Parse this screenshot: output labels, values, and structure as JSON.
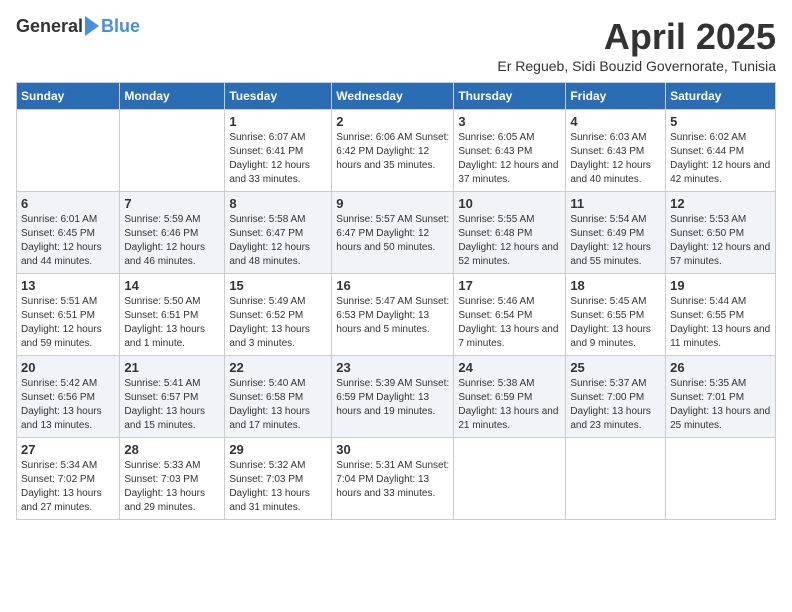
{
  "logo": {
    "general": "General",
    "blue": "Blue"
  },
  "title": {
    "month": "April 2025",
    "location": "Er Regueb, Sidi Bouzid Governorate, Tunisia"
  },
  "columns": [
    "Sunday",
    "Monday",
    "Tuesday",
    "Wednesday",
    "Thursday",
    "Friday",
    "Saturday"
  ],
  "weeks": [
    [
      {
        "day": "",
        "info": ""
      },
      {
        "day": "",
        "info": ""
      },
      {
        "day": "1",
        "info": "Sunrise: 6:07 AM\nSunset: 6:41 PM\nDaylight: 12 hours and 33 minutes."
      },
      {
        "day": "2",
        "info": "Sunrise: 6:06 AM\nSunset: 6:42 PM\nDaylight: 12 hours and 35 minutes."
      },
      {
        "day": "3",
        "info": "Sunrise: 6:05 AM\nSunset: 6:43 PM\nDaylight: 12 hours and 37 minutes."
      },
      {
        "day": "4",
        "info": "Sunrise: 6:03 AM\nSunset: 6:43 PM\nDaylight: 12 hours and 40 minutes."
      },
      {
        "day": "5",
        "info": "Sunrise: 6:02 AM\nSunset: 6:44 PM\nDaylight: 12 hours and 42 minutes."
      }
    ],
    [
      {
        "day": "6",
        "info": "Sunrise: 6:01 AM\nSunset: 6:45 PM\nDaylight: 12 hours and 44 minutes."
      },
      {
        "day": "7",
        "info": "Sunrise: 5:59 AM\nSunset: 6:46 PM\nDaylight: 12 hours and 46 minutes."
      },
      {
        "day": "8",
        "info": "Sunrise: 5:58 AM\nSunset: 6:47 PM\nDaylight: 12 hours and 48 minutes."
      },
      {
        "day": "9",
        "info": "Sunrise: 5:57 AM\nSunset: 6:47 PM\nDaylight: 12 hours and 50 minutes."
      },
      {
        "day": "10",
        "info": "Sunrise: 5:55 AM\nSunset: 6:48 PM\nDaylight: 12 hours and 52 minutes."
      },
      {
        "day": "11",
        "info": "Sunrise: 5:54 AM\nSunset: 6:49 PM\nDaylight: 12 hours and 55 minutes."
      },
      {
        "day": "12",
        "info": "Sunrise: 5:53 AM\nSunset: 6:50 PM\nDaylight: 12 hours and 57 minutes."
      }
    ],
    [
      {
        "day": "13",
        "info": "Sunrise: 5:51 AM\nSunset: 6:51 PM\nDaylight: 12 hours and 59 minutes."
      },
      {
        "day": "14",
        "info": "Sunrise: 5:50 AM\nSunset: 6:51 PM\nDaylight: 13 hours and 1 minute."
      },
      {
        "day": "15",
        "info": "Sunrise: 5:49 AM\nSunset: 6:52 PM\nDaylight: 13 hours and 3 minutes."
      },
      {
        "day": "16",
        "info": "Sunrise: 5:47 AM\nSunset: 6:53 PM\nDaylight: 13 hours and 5 minutes."
      },
      {
        "day": "17",
        "info": "Sunrise: 5:46 AM\nSunset: 6:54 PM\nDaylight: 13 hours and 7 minutes."
      },
      {
        "day": "18",
        "info": "Sunrise: 5:45 AM\nSunset: 6:55 PM\nDaylight: 13 hours and 9 minutes."
      },
      {
        "day": "19",
        "info": "Sunrise: 5:44 AM\nSunset: 6:55 PM\nDaylight: 13 hours and 11 minutes."
      }
    ],
    [
      {
        "day": "20",
        "info": "Sunrise: 5:42 AM\nSunset: 6:56 PM\nDaylight: 13 hours and 13 minutes."
      },
      {
        "day": "21",
        "info": "Sunrise: 5:41 AM\nSunset: 6:57 PM\nDaylight: 13 hours and 15 minutes."
      },
      {
        "day": "22",
        "info": "Sunrise: 5:40 AM\nSunset: 6:58 PM\nDaylight: 13 hours and 17 minutes."
      },
      {
        "day": "23",
        "info": "Sunrise: 5:39 AM\nSunset: 6:59 PM\nDaylight: 13 hours and 19 minutes."
      },
      {
        "day": "24",
        "info": "Sunrise: 5:38 AM\nSunset: 6:59 PM\nDaylight: 13 hours and 21 minutes."
      },
      {
        "day": "25",
        "info": "Sunrise: 5:37 AM\nSunset: 7:00 PM\nDaylight: 13 hours and 23 minutes."
      },
      {
        "day": "26",
        "info": "Sunrise: 5:35 AM\nSunset: 7:01 PM\nDaylight: 13 hours and 25 minutes."
      }
    ],
    [
      {
        "day": "27",
        "info": "Sunrise: 5:34 AM\nSunset: 7:02 PM\nDaylight: 13 hours and 27 minutes."
      },
      {
        "day": "28",
        "info": "Sunrise: 5:33 AM\nSunset: 7:03 PM\nDaylight: 13 hours and 29 minutes."
      },
      {
        "day": "29",
        "info": "Sunrise: 5:32 AM\nSunset: 7:03 PM\nDaylight: 13 hours and 31 minutes."
      },
      {
        "day": "30",
        "info": "Sunrise: 5:31 AM\nSunset: 7:04 PM\nDaylight: 13 hours and 33 minutes."
      },
      {
        "day": "",
        "info": ""
      },
      {
        "day": "",
        "info": ""
      },
      {
        "day": "",
        "info": ""
      }
    ]
  ]
}
